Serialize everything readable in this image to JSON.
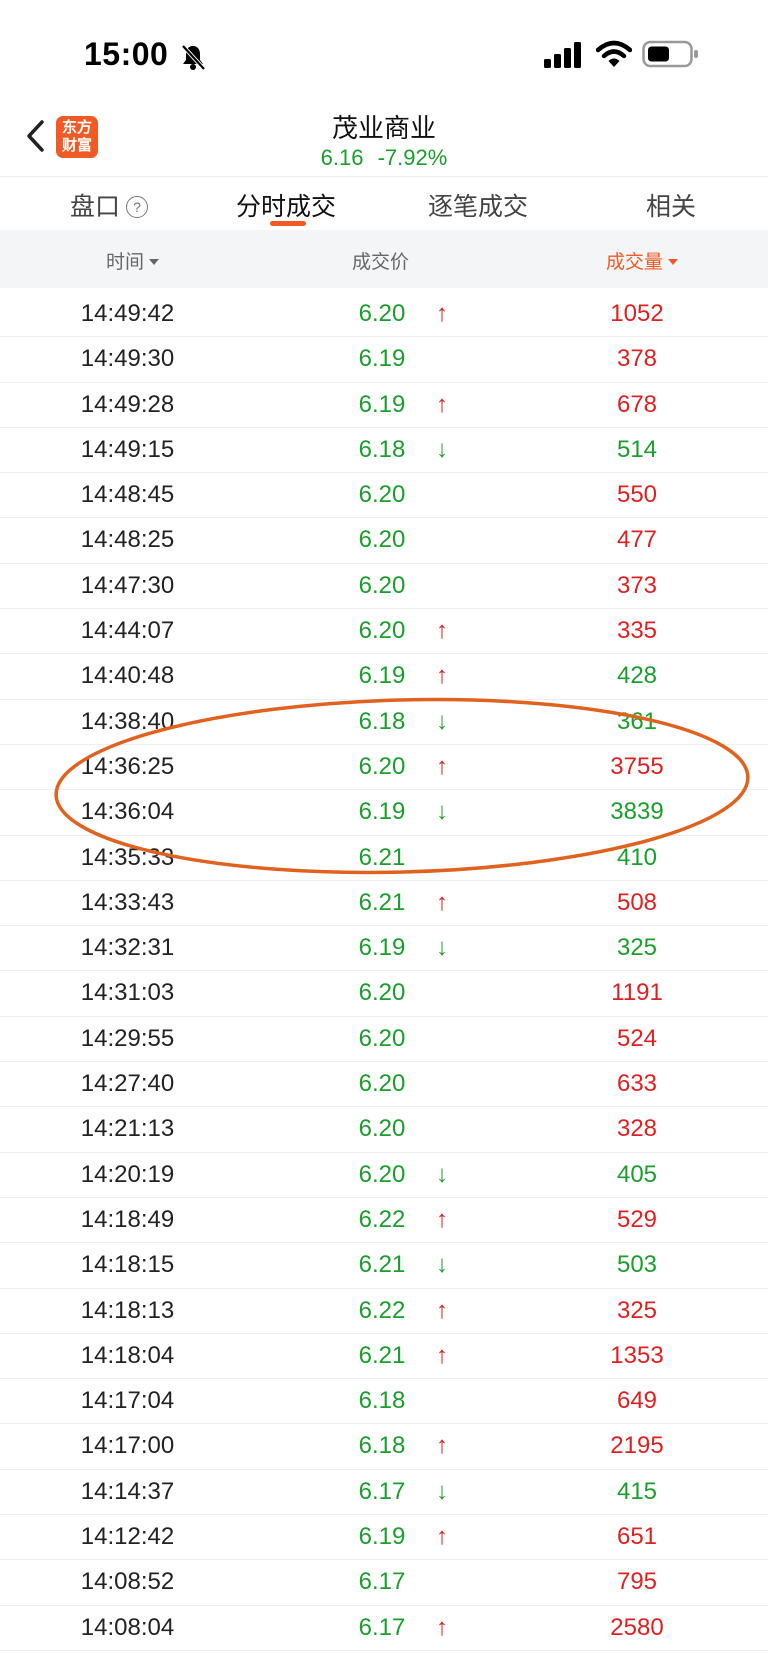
{
  "status": {
    "time": "15:00"
  },
  "header": {
    "logo_line1": "东方",
    "logo_line2": "财富",
    "title": "茂业商业",
    "price": "6.16",
    "change": "-7.92%"
  },
  "tabs": [
    {
      "label": "盘口"
    },
    {
      "label": "分时成交"
    },
    {
      "label": "逐笔成交"
    },
    {
      "label": "相关"
    }
  ],
  "columns": {
    "time": "时间",
    "price": "成交价",
    "volume": "成交量"
  },
  "colors": {
    "up": "#e02020",
    "down": "#1a9e2c",
    "accent": "#f15a24"
  },
  "rows": [
    {
      "time": "14:49:42",
      "price": "6.20",
      "arrow": "↑",
      "dir": "up",
      "volume": "1052",
      "vol_color": "red"
    },
    {
      "time": "14:49:30",
      "price": "6.19",
      "arrow": "",
      "dir": "",
      "volume": "378",
      "vol_color": "red"
    },
    {
      "time": "14:49:28",
      "price": "6.19",
      "arrow": "↑",
      "dir": "up",
      "volume": "678",
      "vol_color": "red"
    },
    {
      "time": "14:49:15",
      "price": "6.18",
      "arrow": "↓",
      "dir": "down",
      "volume": "514",
      "vol_color": "green"
    },
    {
      "time": "14:48:45",
      "price": "6.20",
      "arrow": "",
      "dir": "",
      "volume": "550",
      "vol_color": "red"
    },
    {
      "time": "14:48:25",
      "price": "6.20",
      "arrow": "",
      "dir": "",
      "volume": "477",
      "vol_color": "red"
    },
    {
      "time": "14:47:30",
      "price": "6.20",
      "arrow": "",
      "dir": "",
      "volume": "373",
      "vol_color": "red"
    },
    {
      "time": "14:44:07",
      "price": "6.20",
      "arrow": "↑",
      "dir": "up",
      "volume": "335",
      "vol_color": "red"
    },
    {
      "time": "14:40:48",
      "price": "6.19",
      "arrow": "↑",
      "dir": "up",
      "volume": "428",
      "vol_color": "green"
    },
    {
      "time": "14:38:40",
      "price": "6.18",
      "arrow": "↓",
      "dir": "down",
      "volume": "361",
      "vol_color": "green"
    },
    {
      "time": "14:36:25",
      "price": "6.20",
      "arrow": "↑",
      "dir": "up",
      "volume": "3755",
      "vol_color": "red"
    },
    {
      "time": "14:36:04",
      "price": "6.19",
      "arrow": "↓",
      "dir": "down",
      "volume": "3839",
      "vol_color": "green"
    },
    {
      "time": "14:35:33",
      "price": "6.21",
      "arrow": "",
      "dir": "",
      "volume": "410",
      "vol_color": "green"
    },
    {
      "time": "14:33:43",
      "price": "6.21",
      "arrow": "↑",
      "dir": "up",
      "volume": "508",
      "vol_color": "red"
    },
    {
      "time": "14:32:31",
      "price": "6.19",
      "arrow": "↓",
      "dir": "down",
      "volume": "325",
      "vol_color": "green"
    },
    {
      "time": "14:31:03",
      "price": "6.20",
      "arrow": "",
      "dir": "",
      "volume": "1191",
      "vol_color": "red"
    },
    {
      "time": "14:29:55",
      "price": "6.20",
      "arrow": "",
      "dir": "",
      "volume": "524",
      "vol_color": "red"
    },
    {
      "time": "14:27:40",
      "price": "6.20",
      "arrow": "",
      "dir": "",
      "volume": "633",
      "vol_color": "red"
    },
    {
      "time": "14:21:13",
      "price": "6.20",
      "arrow": "",
      "dir": "",
      "volume": "328",
      "vol_color": "red"
    },
    {
      "time": "14:20:19",
      "price": "6.20",
      "arrow": "↓",
      "dir": "down",
      "volume": "405",
      "vol_color": "green"
    },
    {
      "time": "14:18:49",
      "price": "6.22",
      "arrow": "↑",
      "dir": "up",
      "volume": "529",
      "vol_color": "red"
    },
    {
      "time": "14:18:15",
      "price": "6.21",
      "arrow": "↓",
      "dir": "down",
      "volume": "503",
      "vol_color": "green"
    },
    {
      "time": "14:18:13",
      "price": "6.22",
      "arrow": "↑",
      "dir": "up",
      "volume": "325",
      "vol_color": "red"
    },
    {
      "time": "14:18:04",
      "price": "6.21",
      "arrow": "↑",
      "dir": "up",
      "volume": "1353",
      "vol_color": "red"
    },
    {
      "time": "14:17:04",
      "price": "6.18",
      "arrow": "",
      "dir": "",
      "volume": "649",
      "vol_color": "red"
    },
    {
      "time": "14:17:00",
      "price": "6.18",
      "arrow": "↑",
      "dir": "up",
      "volume": "2195",
      "vol_color": "red"
    },
    {
      "time": "14:14:37",
      "price": "6.17",
      "arrow": "↓",
      "dir": "down",
      "volume": "415",
      "vol_color": "green"
    },
    {
      "time": "14:12:42",
      "price": "6.19",
      "arrow": "↑",
      "dir": "up",
      "volume": "651",
      "vol_color": "red"
    },
    {
      "time": "14:08:52",
      "price": "6.17",
      "arrow": "",
      "dir": "",
      "volume": "795",
      "vol_color": "red"
    },
    {
      "time": "14:08:04",
      "price": "6.17",
      "arrow": "↑",
      "dir": "up",
      "volume": "2580",
      "vol_color": "red"
    }
  ]
}
